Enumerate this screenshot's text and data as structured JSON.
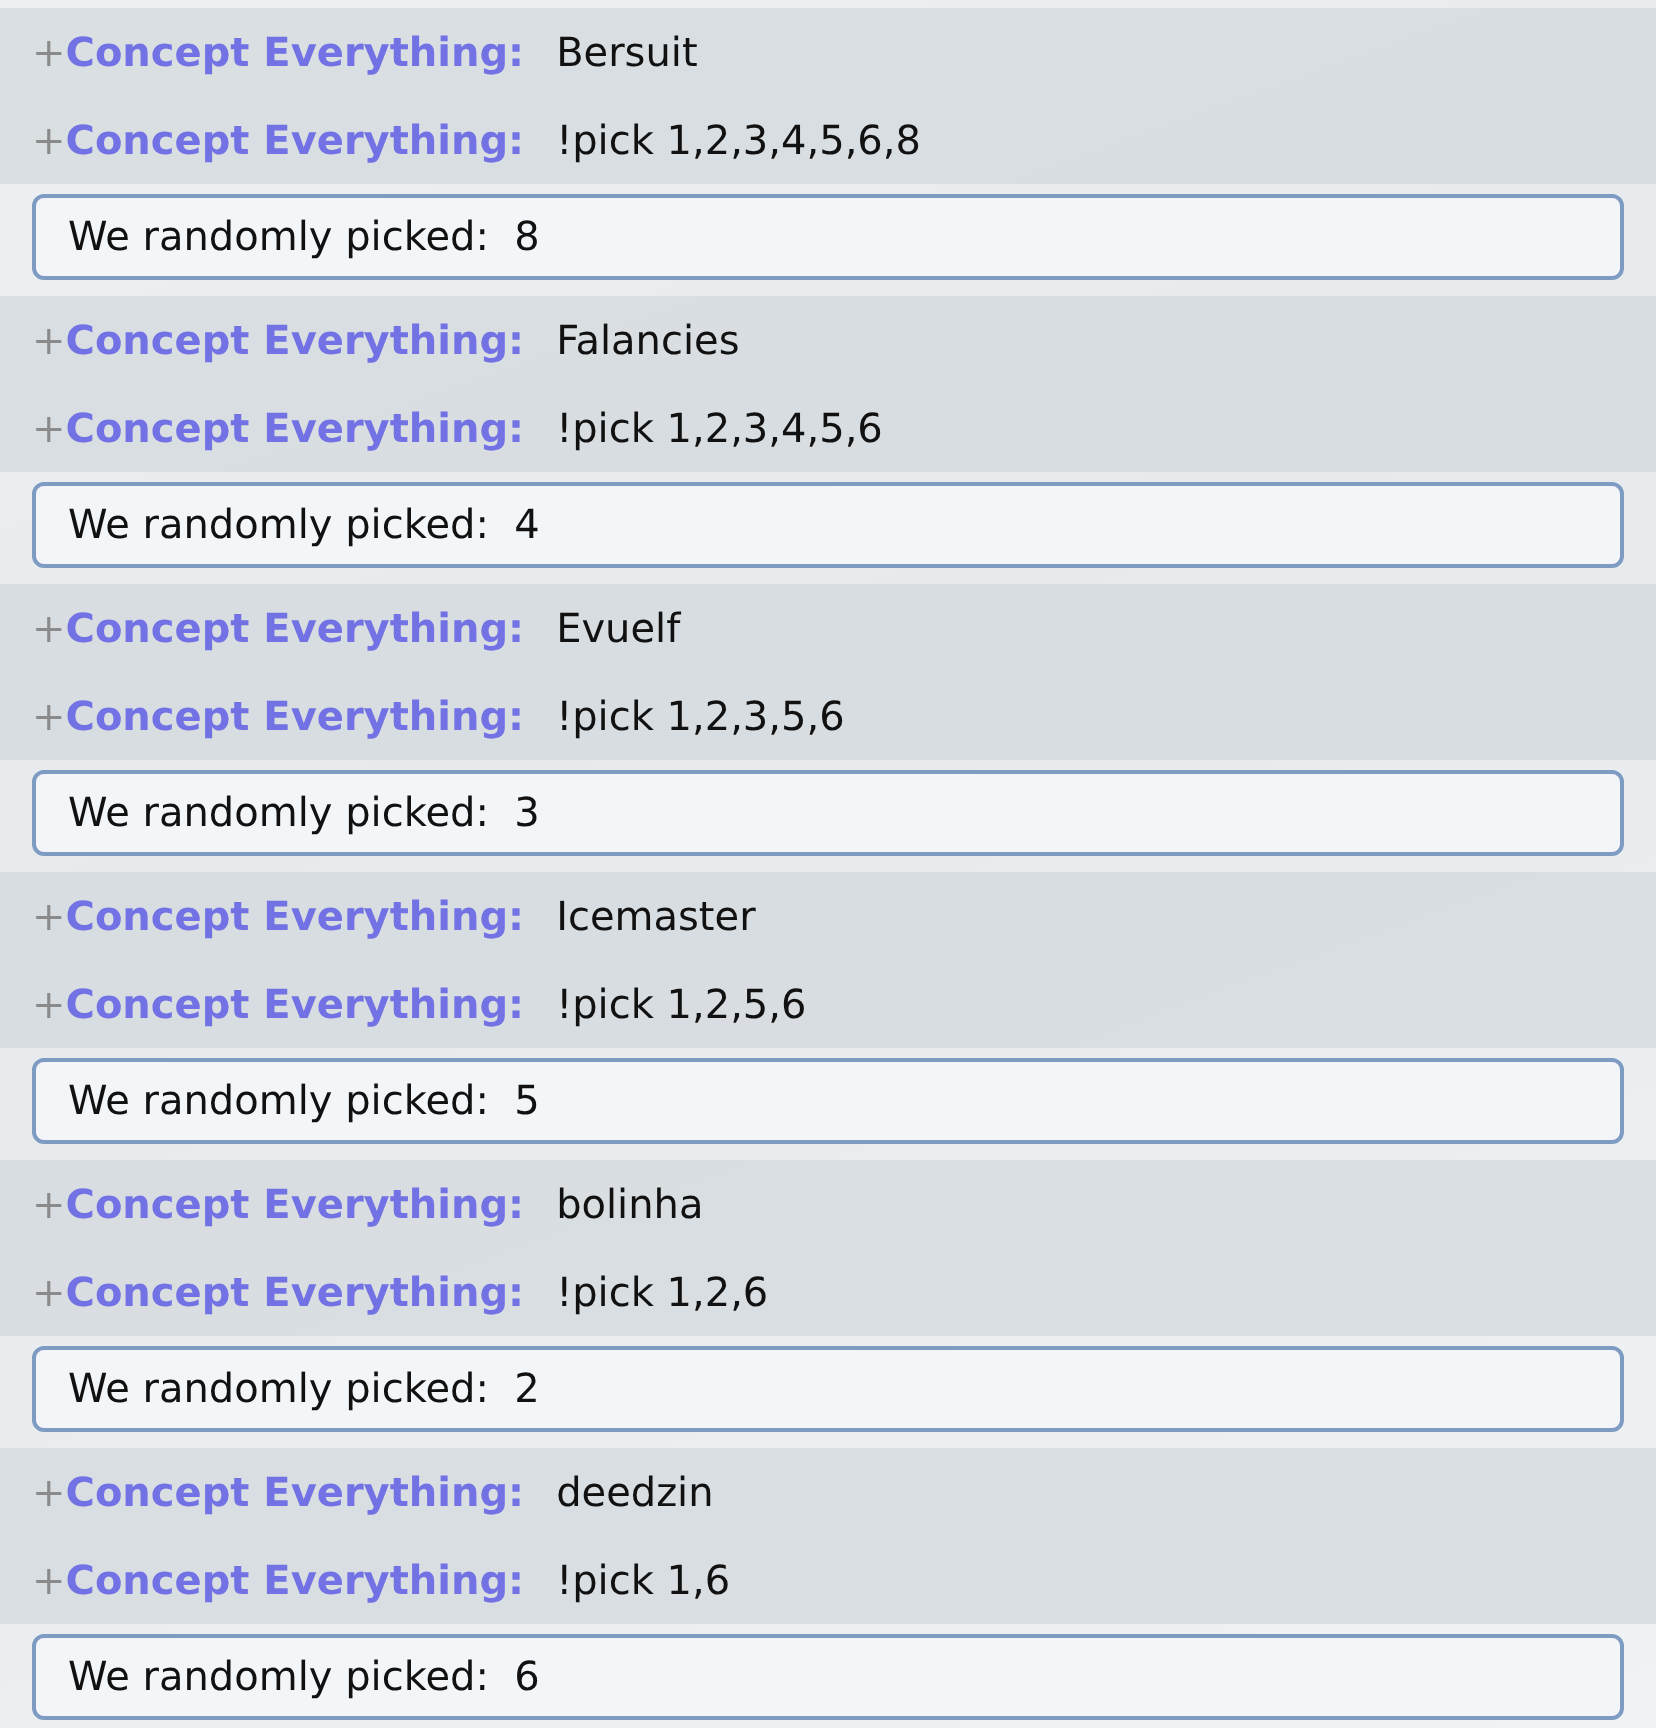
{
  "messages": [
    {
      "kind": "chat",
      "rank": "+",
      "user": "Concept Everything:",
      "text": "Bersuit"
    },
    {
      "kind": "chat",
      "rank": "+",
      "user": "Concept Everything:",
      "text": "!pick 1,2,3,4,5,6,8"
    },
    {
      "kind": "bot",
      "text": "We randomly picked:  8"
    },
    {
      "kind": "chat",
      "rank": "+",
      "user": "Concept Everything:",
      "text": "Falancies"
    },
    {
      "kind": "chat",
      "rank": "+",
      "user": "Concept Everything:",
      "text": "!pick 1,2,3,4,5,6"
    },
    {
      "kind": "bot",
      "text": "We randomly picked:  4"
    },
    {
      "kind": "chat",
      "rank": "+",
      "user": "Concept Everything:",
      "text": "Evuelf"
    },
    {
      "kind": "chat",
      "rank": "+",
      "user": "Concept Everything:",
      "text": "!pick 1,2,3,5,6"
    },
    {
      "kind": "bot",
      "text": "We randomly picked:  3"
    },
    {
      "kind": "chat",
      "rank": "+",
      "user": "Concept Everything:",
      "text": "Icemaster"
    },
    {
      "kind": "chat",
      "rank": "+",
      "user": "Concept Everything:",
      "text": "!pick 1,2,5,6"
    },
    {
      "kind": "bot",
      "text": "We randomly picked:  5"
    },
    {
      "kind": "chat",
      "rank": "+",
      "user": "Concept Everything:",
      "text": "bolinha"
    },
    {
      "kind": "chat",
      "rank": "+",
      "user": "Concept Everything:",
      "text": "!pick 1,2,6"
    },
    {
      "kind": "bot",
      "text": "We randomly picked:  2"
    },
    {
      "kind": "chat",
      "rank": "+",
      "user": "Concept Everything:",
      "text": "deedzin"
    },
    {
      "kind": "chat",
      "rank": "+",
      "user": "Concept Everything:",
      "text": "!pick 1,6"
    },
    {
      "kind": "bot",
      "text": "We randomly picked:  6"
    }
  ]
}
